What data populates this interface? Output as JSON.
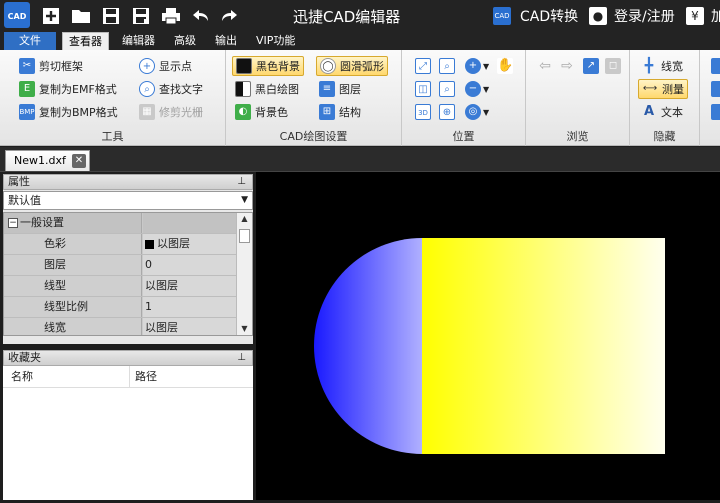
{
  "app": {
    "title": "迅捷CAD编辑器",
    "logo_text": "CAD",
    "cad_convert": "CAD转换",
    "login": "登录/注册",
    "yen": "¥",
    "cut_off": "加"
  },
  "menu": {
    "file": "文件",
    "tabs": [
      "查看器",
      "编辑器",
      "高级",
      "输出",
      "VIP功能"
    ]
  },
  "ribbon": {
    "tools": {
      "label": "工具",
      "clip_frame": "剪切框架",
      "copy_emf": "复制为EMF格式",
      "copy_bmp": "复制为BMP格式",
      "show_points": "显示点",
      "find_text": "查找文字",
      "trim_raster": "修剪光栅"
    },
    "cad_settings": {
      "label": "CAD绘图设置",
      "black_bg": "黑色背景",
      "bw_draw": "黑白绘图",
      "bg_color": "背景色",
      "smooth_arc": "圆滑弧形",
      "layers": "图层",
      "structure": "结构"
    },
    "position": {
      "label": "位置"
    },
    "browse": {
      "label": "浏览"
    },
    "hide": {
      "label": "隐藏",
      "line_width": "线宽",
      "measure": "测量",
      "text": "文本"
    }
  },
  "document": {
    "tab": "New1.dxf"
  },
  "properties": {
    "title": "属性",
    "selector": "默认值",
    "group": "一般设置",
    "rows": [
      {
        "key": "色彩",
        "value": "以图层"
      },
      {
        "key": "图层",
        "value": "0"
      },
      {
        "key": "线型",
        "value": "以图层"
      },
      {
        "key": "线型比例",
        "value": "1"
      },
      {
        "key": "线宽",
        "value": "以图层"
      }
    ]
  },
  "favorites": {
    "title": "收藏夹",
    "col_name": "名称",
    "col_path": "路径"
  },
  "colors": {
    "rect_gradient": [
      "#ffff00",
      "#ffffff"
    ],
    "semicircle_gradient": [
      "#1a1aff",
      "#b0b0ff"
    ]
  }
}
